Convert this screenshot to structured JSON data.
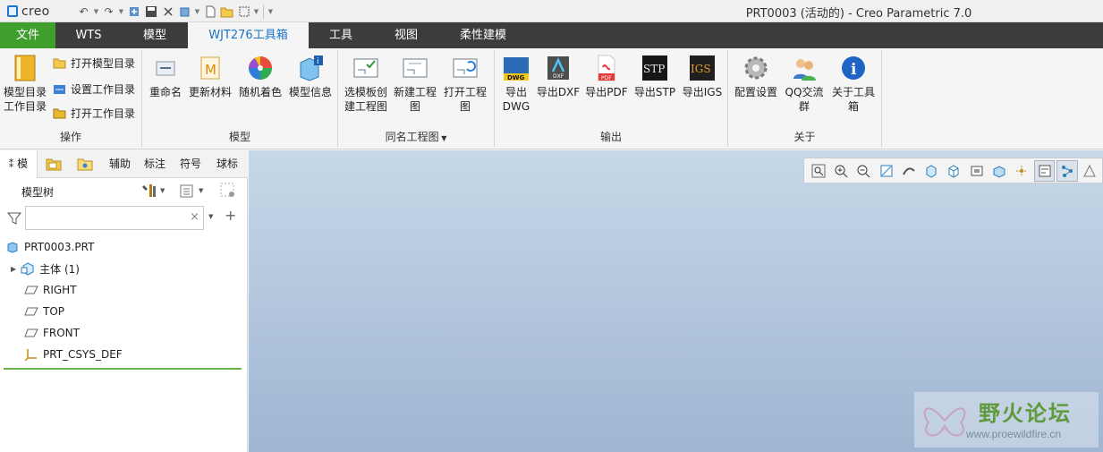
{
  "app": {
    "logo_text": "creo",
    "window_title": "PRT0003 (活动的) - Creo Parametric 7.0"
  },
  "ribbon_tabs": [
    "文件",
    "WTS",
    "模型",
    "WJT276工具箱",
    "工具",
    "视图",
    "柔性建模"
  ],
  "active_tab": "WJT276工具箱",
  "groups": {
    "operate": {
      "label": "操作",
      "big": "模型目录工作目录",
      "big_line1": "模型目录",
      "big_line2": "工作目录",
      "small": [
        "打开模型目录",
        "设置工作目录",
        "打开工作目录"
      ]
    },
    "model": {
      "label": "模型",
      "buttons": [
        "重命名",
        "更新材料",
        "随机着色",
        "模型信息"
      ]
    },
    "drawing": {
      "label": "同名工程图",
      "buttons": [
        {
          "line1": "选模板创",
          "line2": "建工程图"
        },
        {
          "line1": "新建工程",
          "line2": "图"
        },
        {
          "line1": "打开工程",
          "line2": "图"
        }
      ]
    },
    "output": {
      "label": "输出",
      "buttons": [
        {
          "line1": "导出",
          "line2": "DWG",
          "icon_text": "DWG"
        },
        {
          "line1": "导出DXF",
          "line2": "",
          "icon_text": "DXF"
        },
        {
          "line1": "导出PDF",
          "line2": "",
          "icon_text": "PDF"
        },
        {
          "line1": "导出STP",
          "line2": "",
          "icon_text": "STP"
        },
        {
          "line1": "导出IGS",
          "line2": "",
          "icon_text": "IGS"
        }
      ]
    },
    "about": {
      "label": "关于",
      "buttons": [
        {
          "line1": "配置设置",
          "line2": ""
        },
        {
          "line1": "QQ交流",
          "line2": "群"
        },
        {
          "line1": "关于工具",
          "line2": "箱"
        }
      ]
    }
  },
  "panel": {
    "tabs": [
      "模",
      "辅助",
      "标注",
      "符号",
      "球标"
    ],
    "tree_title": "模型树",
    "filter_value": "",
    "tree": [
      {
        "label": "PRT0003.PRT",
        "icon": "part-icon"
      },
      {
        "label": "主体 (1)",
        "icon": "body-icon"
      },
      {
        "label": "RIGHT",
        "icon": "datum-plane-icon"
      },
      {
        "label": "TOP",
        "icon": "datum-plane-icon"
      },
      {
        "label": "FRONT",
        "icon": "datum-plane-icon"
      },
      {
        "label": "PRT_CSYS_DEF",
        "icon": "csys-icon"
      }
    ]
  },
  "watermark": {
    "text": "野火论坛",
    "url": "www.proewildfire.cn"
  },
  "colors": {
    "file_tab": "#3f9f2d",
    "active_tab_text": "#1874c8",
    "tabbar": "#3c3c3c",
    "graphics_top": "#c6d8e8",
    "graphics_bottom": "#9fb6d2"
  }
}
